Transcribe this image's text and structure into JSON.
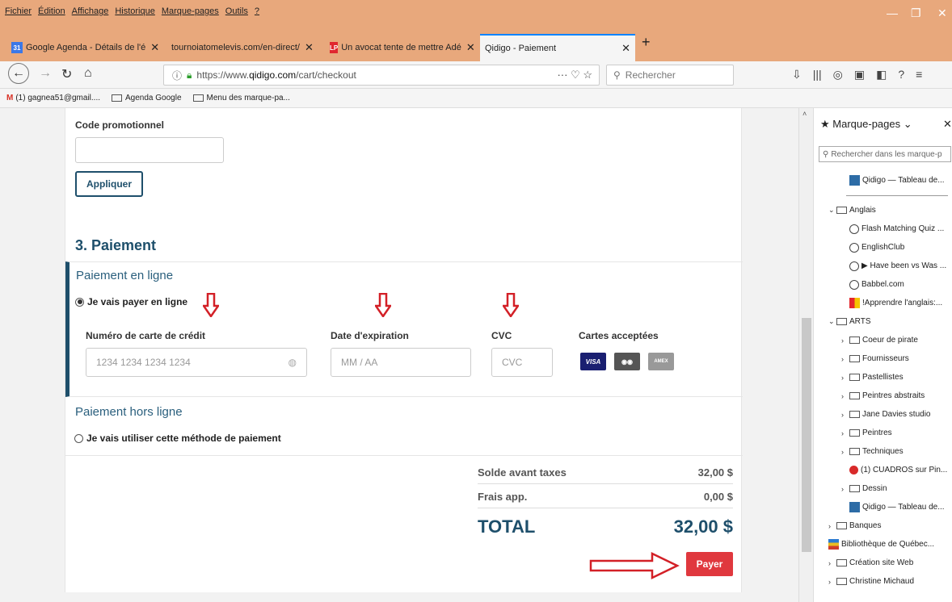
{
  "menubar": {
    "items": [
      "Fichier",
      "Édition",
      "Affichage",
      "Historique",
      "Marque-pages",
      "Outils",
      "?"
    ]
  },
  "tabs": [
    {
      "label": "Google Agenda - Détails de l'é",
      "favicon": "31",
      "color": "#3b78e7"
    },
    {
      "label": "tournoiatomelevis.com/en-direct/",
      "favicon": "",
      "color": ""
    },
    {
      "label": "Un avocat tente de mettre Adé",
      "favicon": "LP",
      "color": "#e0272f"
    },
    {
      "label": "Qidigo - Paiement",
      "favicon": "",
      "color": ""
    }
  ],
  "url": {
    "prefix": "https://www.",
    "domain": "qidigo.com",
    "path": "/cart/checkout"
  },
  "search_placeholder": "Rechercher",
  "bookmarks_bar": {
    "gmail": "(1) gagnea51@gmail....",
    "agenda": "Agenda Google",
    "menu": "Menu des marque-pa..."
  },
  "promo": {
    "label": "Code promotionnel",
    "apply": "Appliquer"
  },
  "payment": {
    "section_title": "3. Paiement",
    "online_title": "Paiement en ligne",
    "online_radio": "Je vais payer en ligne",
    "card_number_label": "Numéro de carte de crédit",
    "card_number_placeholder": "1234 1234 1234 1234",
    "expiry_label": "Date d'expiration",
    "expiry_placeholder": "MM / AA",
    "cvc_label": "CVC",
    "cvc_placeholder": "CVC",
    "accepted_label": "Cartes acceptées",
    "offline_title": "Paiement hors ligne",
    "offline_radio": "Je vais utiliser cette méthode de paiement"
  },
  "summary": {
    "subtotal_label": "Solde avant taxes",
    "subtotal_value": "32,00 $",
    "fees_label": "Frais app.",
    "fees_value": "0,00 $",
    "total_label": "TOTAL",
    "total_value": "32,00 $",
    "pay_button": "Payer"
  },
  "sidebar": {
    "title": "Marque-pages",
    "search_placeholder": "Rechercher dans les marque-p",
    "items": [
      {
        "type": "qidigo",
        "label": "Qidigo — Tableau de...",
        "level": 2
      },
      {
        "type": "separator"
      },
      {
        "type": "folder-open",
        "label": "Anglais",
        "level": 1
      },
      {
        "type": "globe",
        "label": "Flash Matching Quiz ...",
        "level": 2
      },
      {
        "type": "globe",
        "label": "EnglishClub",
        "level": 2
      },
      {
        "type": "globe",
        "label": "▶ Have been vs Was ...",
        "level": 2
      },
      {
        "type": "globe",
        "label": "Babbel.com",
        "level": 2
      },
      {
        "type": "multi",
        "label": "!Apprendre l'anglais:...",
        "level": 2
      },
      {
        "type": "folder-open",
        "label": "ARTS",
        "level": 1
      },
      {
        "type": "folder",
        "label": "Coeur de pirate",
        "level": 2
      },
      {
        "type": "folder",
        "label": "Fournisseurs",
        "level": 2
      },
      {
        "type": "folder",
        "label": "Pastellistes",
        "level": 2
      },
      {
        "type": "folder",
        "label": "Peintres abstraits",
        "level": 2
      },
      {
        "type": "folder",
        "label": "Jane Davies studio",
        "level": 2
      },
      {
        "type": "folder",
        "label": "Peintres",
        "level": 2
      },
      {
        "type": "folder",
        "label": "Techniques",
        "level": 2
      },
      {
        "type": "pin",
        "label": "(1) CUADROS sur Pin...",
        "level": 2
      },
      {
        "type": "folder",
        "label": "Dessin",
        "level": 2
      },
      {
        "type": "qidigo",
        "label": "Qidigo — Tableau de...",
        "level": 2
      },
      {
        "type": "folder",
        "label": "Banques",
        "level": 1
      },
      {
        "type": "bibl",
        "label": "Bibliothèque de Québec...",
        "level": 1
      },
      {
        "type": "folder",
        "label": "Création site Web",
        "level": 1
      },
      {
        "type": "folder",
        "label": "Christine Michaud",
        "level": 1
      }
    ]
  },
  "colors": {
    "accent": "#1e4f6b",
    "pay": "#e0383e",
    "annotation_arrow": "#d32027"
  }
}
